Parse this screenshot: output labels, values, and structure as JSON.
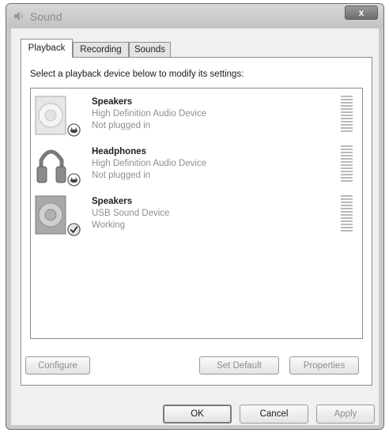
{
  "window": {
    "title": "Sound",
    "close_label": "x"
  },
  "tabs": [
    {
      "label": "Playback",
      "active": true
    },
    {
      "label": "Recording",
      "active": false
    },
    {
      "label": "Sounds",
      "active": false
    }
  ],
  "instruction": "Select a playback device below to modify its settings:",
  "devices": [
    {
      "name": "Speakers",
      "description": "High Definition Audio Device",
      "status": "Not plugged in",
      "icon": "speaker-icon",
      "badge": "unplugged-badge-icon"
    },
    {
      "name": "Headphones",
      "description": "High Definition Audio Device",
      "status": "Not plugged in",
      "icon": "headphones-icon",
      "badge": "unplugged-badge-icon"
    },
    {
      "name": "Speakers",
      "description": "USB Sound Device",
      "status": "Working",
      "icon": "speaker-icon",
      "badge": "checkmark-badge-icon"
    }
  ],
  "panel_buttons": {
    "configure": "Configure",
    "set_default": "Set Default",
    "properties": "Properties"
  },
  "dialog_buttons": {
    "ok": "OK",
    "cancel": "Cancel",
    "apply": "Apply"
  }
}
